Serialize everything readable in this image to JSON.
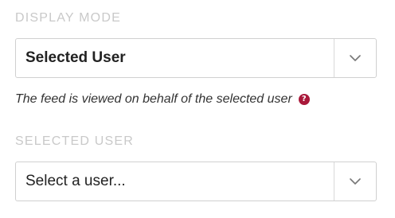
{
  "display_mode": {
    "label": "DISPLAY MODE",
    "selected_value": "Selected User",
    "help_text": "The feed is viewed on behalf of the selected user",
    "help_icon_glyph": "?",
    "help_icon_name": "question-circle-icon",
    "help_icon_color": "#a9183a"
  },
  "selected_user": {
    "label": "SELECTED USER",
    "placeholder": "Select a user..."
  },
  "icons": {
    "chevron": "chevron-down-icon"
  },
  "colors": {
    "section_label": "#c9c9c9",
    "border": "#d0d0d0",
    "text": "#222222"
  }
}
